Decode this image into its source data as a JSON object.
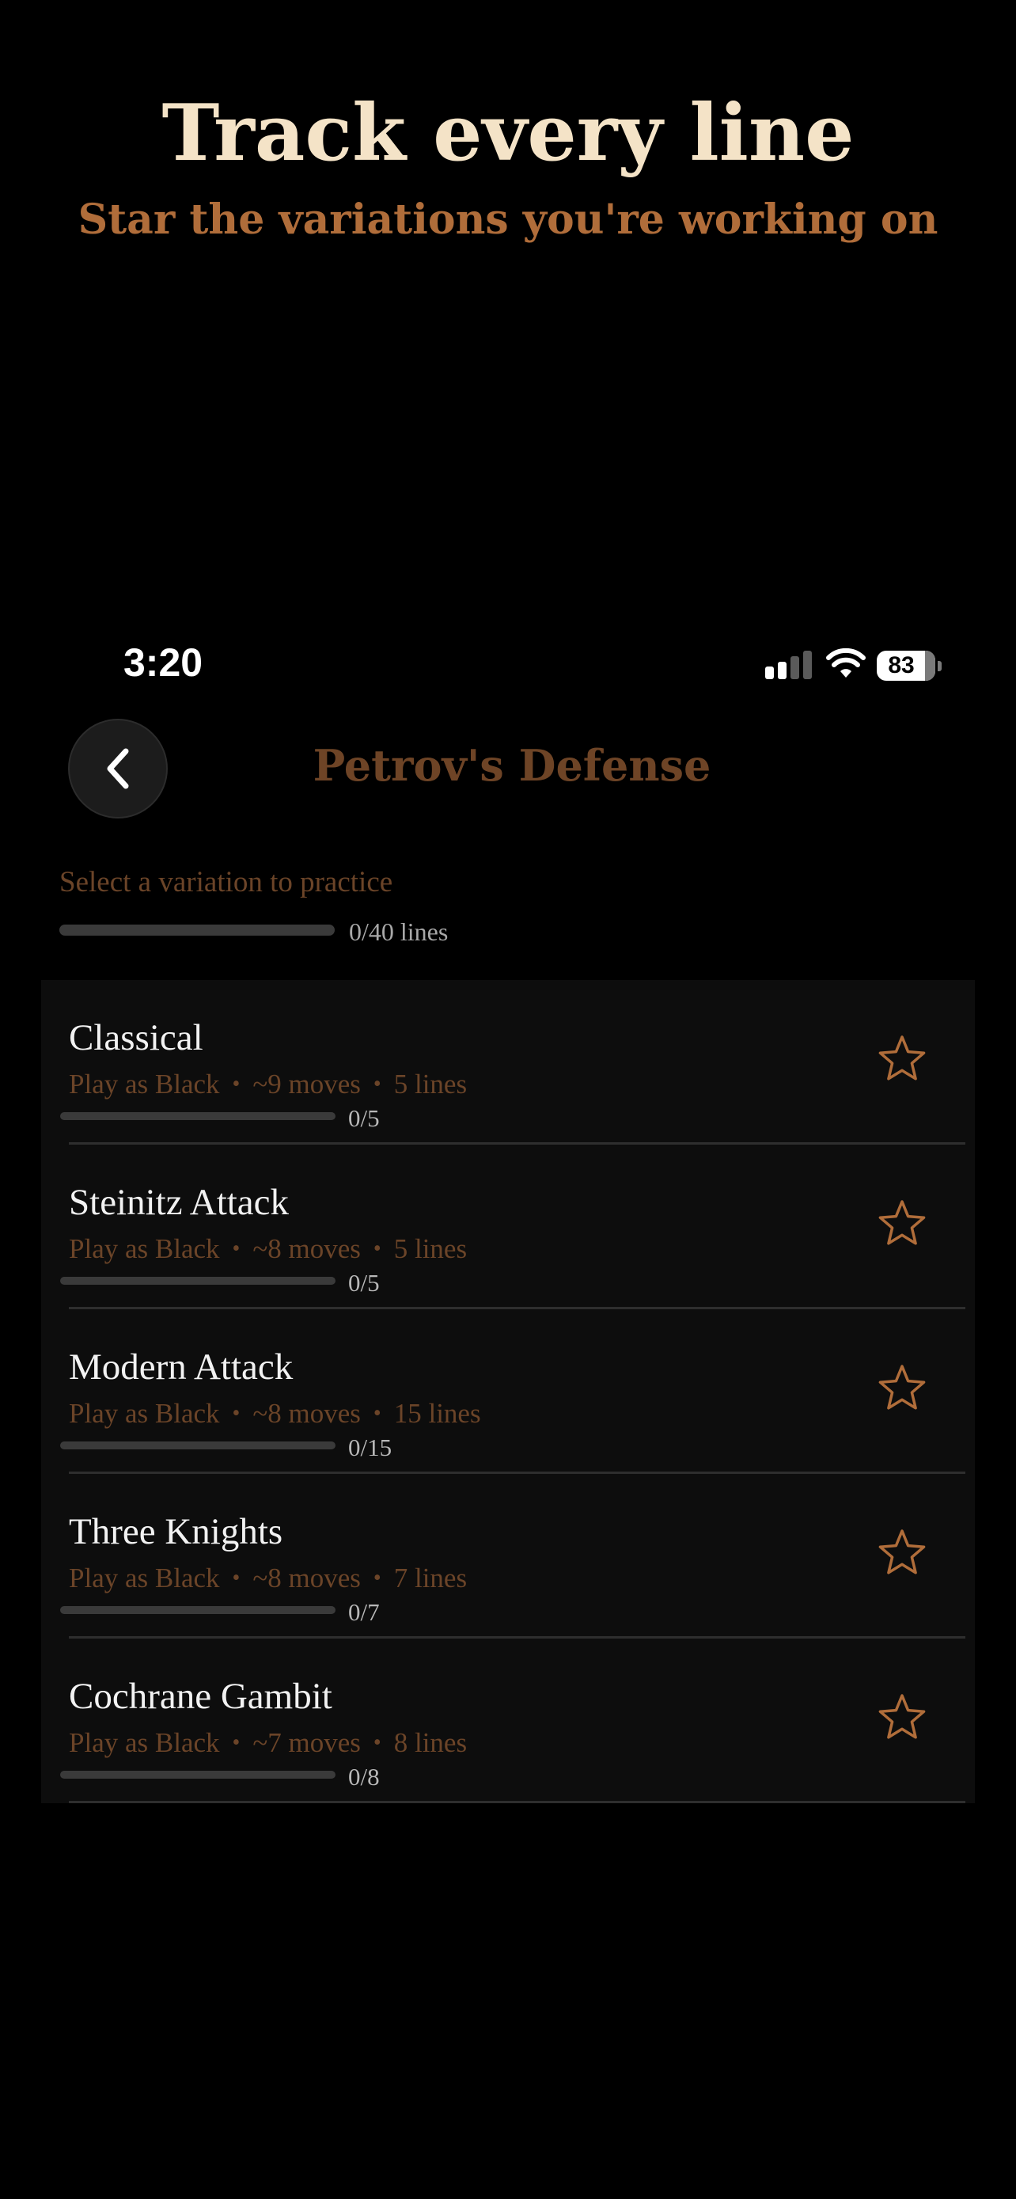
{
  "promo": {
    "title": "Track every line",
    "subtitle": "Star the variations you're working on"
  },
  "status_bar": {
    "time": "3:20",
    "battery_percent": "83",
    "battery_level": 0.83,
    "signal_bars_active": 2,
    "signal_bars_total": 4
  },
  "nav": {
    "back_icon": "chevron-left-icon",
    "title": "Petrov's Defense"
  },
  "overview": {
    "instruction": "Select a variation to practice",
    "progress_label": "0/40 lines",
    "progress_fraction": 0
  },
  "variations": [
    {
      "name": "Classical",
      "side": "Play as Black",
      "moves": "~9 moves",
      "lines": "5 lines",
      "progress": "0/5",
      "progress_fraction": 0,
      "starred": false
    },
    {
      "name": "Steinitz Attack",
      "side": "Play as Black",
      "moves": "~8 moves",
      "lines": "5 lines",
      "progress": "0/5",
      "progress_fraction": 0,
      "starred": false
    },
    {
      "name": "Modern Attack",
      "side": "Play as Black",
      "moves": "~8 moves",
      "lines": "15 lines",
      "progress": "0/15",
      "progress_fraction": 0,
      "starred": false
    },
    {
      "name": "Three Knights",
      "side": "Play as Black",
      "moves": "~8 moves",
      "lines": "7 lines",
      "progress": "0/7",
      "progress_fraction": 0,
      "starred": false
    },
    {
      "name": "Cochrane Gambit",
      "side": "Play as Black",
      "moves": "~7 moves",
      "lines": "8 lines",
      "progress": "0/8",
      "progress_fraction": 0,
      "starred": false
    }
  ],
  "meta_separator": "•",
  "colors": {
    "background": "#000000",
    "accent": "#b06d3a",
    "promo_title": "#f4e3c7",
    "muted_brown": "#6b4428",
    "panel": "#0d0d0d"
  }
}
